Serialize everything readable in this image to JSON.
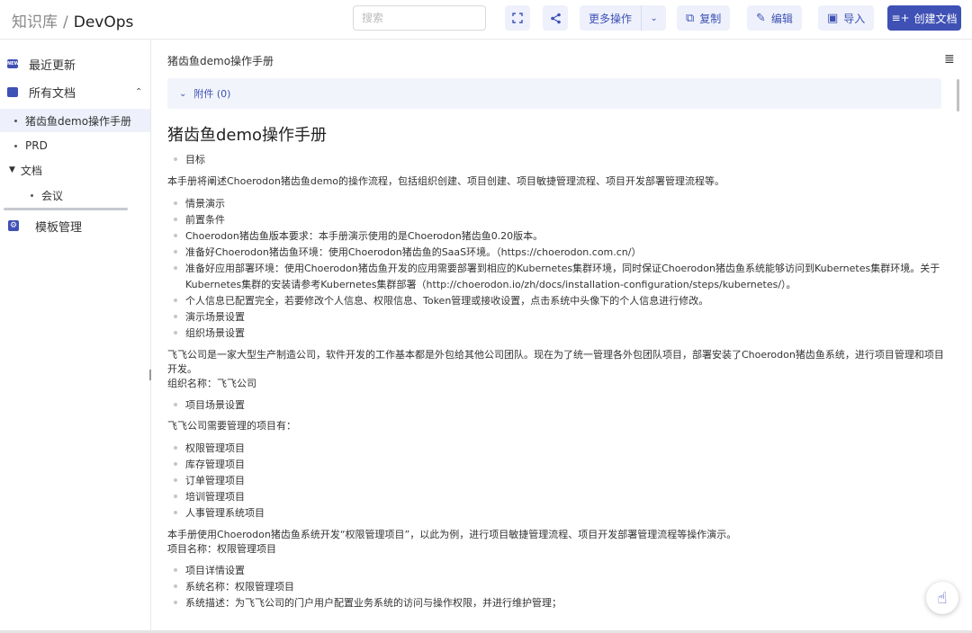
{
  "header": {
    "breadcrumb_root": "知识库",
    "breadcrumb_sep": "/",
    "breadcrumb_current": "DevOps",
    "search_placeholder": "搜索",
    "more_actions_label": "更多操作",
    "copy_label": "复制",
    "edit_label": "编辑",
    "import_label": "导入",
    "create_label": "创建文档"
  },
  "sidebar": {
    "recent_label": "最近更新",
    "recent_icon_text": "NEW",
    "all_docs_label": "所有文档",
    "tree": [
      {
        "label": "猪齿鱼demo操作手册"
      },
      {
        "label": "PRD"
      },
      {
        "label": "文档"
      },
      {
        "label": "会议"
      }
    ],
    "templates_label": "模板管理"
  },
  "main": {
    "title_bar": "猪齿鱼demo操作手册",
    "attachments_label": "附件 (0)",
    "heading": "猪齿鱼demo操作手册",
    "goal_items": [
      "目标"
    ],
    "intro": "本手册将阐述Choerodon猪齿鱼demo的操作流程，包括组织创建、项目创建、项目敏捷管理流程、项目开发部署管理流程等。",
    "scene_items": [
      "情景演示",
      "前置条件",
      "Choerodon猪齿鱼版本要求：本手册演示使用的是Choerodon猪齿鱼0.20版本。",
      "准备好Choerodon猪齿鱼环境：使用Choerodon猪齿鱼的SaaS环境。（https://choerodon.com.cn/）",
      "准备好应用部署环境：使用Choerodon猪齿鱼开发的应用需要部署到相应的Kubernetes集群环境，同时保证Choerodon猪齿鱼系统能够访问到Kubernetes集群环境。关于Kubernetes集群的安装请参考Kubernetes集群部署（http://choerodon.io/zh/docs/installation-configuration/steps/kubernetes/）。",
      "个人信息已配置完全，若要修改个人信息、权限信息、Token管理或接收设置，点击系统中头像下的个人信息进行修改。",
      "演示场景设置",
      "组织场景设置"
    ],
    "company_para": "飞飞公司是一家大型生产制造公司，软件开发的工作基本都是外包给其他公司团队。现在为了统一管理各外包团队项目，部署安装了Choerodon猪齿鱼系统，进行项目管理和项目开发。",
    "org_name": "组织名称：飞飞公司",
    "project_scene_items": [
      "项目场景设置"
    ],
    "projects_intro": "飞飞公司需要管理的项目有：",
    "project_items": [
      "权限管理项目",
      "库存管理项目",
      "订单管理项目",
      "培训管理项目",
      "人事管理系统项目"
    ],
    "manual_para": "本手册使用Choerodon猪齿鱼系统开发“权限管理项目”，以此为例，进行项目敏捷管理流程、项目开发部署管理流程等操作演示。",
    "project_name": "项目名称：权限管理项目",
    "detail_items": [
      "项目详情设置",
      "系统名称：权限管理项目",
      "系统描述：为飞飞公司的门户用户配置业务系统的访问与操作权限，并进行维护管理；"
    ]
  },
  "colors": {
    "accent": "#3f51b5",
    "accent_light": "#eef1fb"
  }
}
